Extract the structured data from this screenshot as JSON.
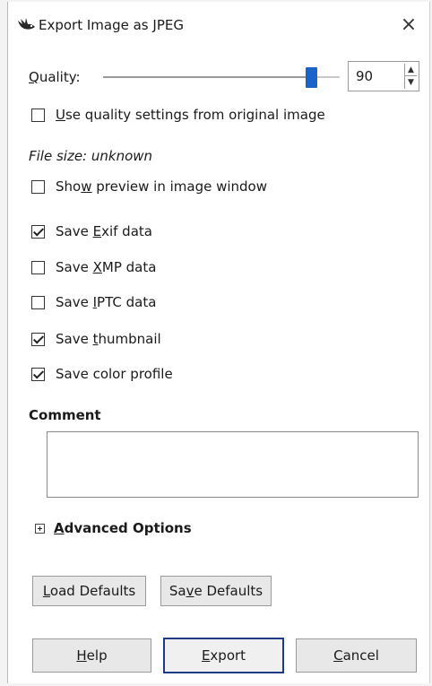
{
  "window": {
    "title": "Export Image as JPEG",
    "close_label": "×",
    "icon": "gimp-wilber-icon"
  },
  "quality": {
    "label": "Quality:",
    "value": "90",
    "slider_value": 90,
    "slider_max": 100
  },
  "use_original_quality": {
    "label": "Use quality settings from original image",
    "checked": false
  },
  "file_size": "File size: unknown",
  "options": [
    {
      "id": "show-preview",
      "label": "Show preview in image window",
      "checked": false
    },
    {
      "id": "save-exif",
      "label": "Save Exif data",
      "checked": true
    },
    {
      "id": "save-xmp",
      "label": "Save XMP data",
      "checked": false
    },
    {
      "id": "save-iptc",
      "label": "Save IPTC data",
      "checked": false
    },
    {
      "id": "save-thumbnail",
      "label": "Save thumbnail",
      "checked": true
    },
    {
      "id": "save-color-profile",
      "label": "Save color profile",
      "checked": true
    }
  ],
  "comment": {
    "heading": "Comment",
    "value": ""
  },
  "advanced": {
    "label": "Advanced Options"
  },
  "buttons": {
    "load_defaults": "Load Defaults",
    "save_defaults": "Save Defaults",
    "help": "Help",
    "export": "Export",
    "cancel": "Cancel"
  },
  "colors": {
    "accent": "#1a63c9",
    "primary_border": "#1f3b86"
  }
}
